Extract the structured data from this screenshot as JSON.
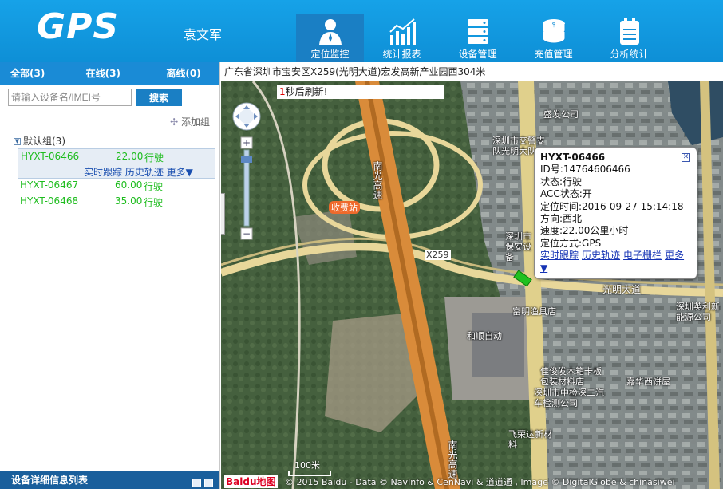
{
  "header": {
    "logo": "GPS",
    "username": "袁文军",
    "nav": [
      {
        "label": "定位监控",
        "icon": "person-icon",
        "active": true
      },
      {
        "label": "统计报表",
        "icon": "chart-icon",
        "active": false
      },
      {
        "label": "设备管理",
        "icon": "server-icon",
        "active": false
      },
      {
        "label": "充值管理",
        "icon": "coins-icon",
        "active": false
      },
      {
        "label": "分析统计",
        "icon": "clipboard-icon",
        "active": false
      }
    ]
  },
  "left": {
    "tabs": [
      "全部(3)",
      "在线(3)",
      "离线(0)"
    ],
    "search_placeholder": "请输入设备名/IMEI号",
    "search_button": "搜索",
    "add_group": "添加组",
    "group_label": "默认组(3)",
    "vehicles": [
      {
        "name": "HYXT-06466",
        "speed": "22.00",
        "status": "行驶"
      },
      {
        "name": "HYXT-06467",
        "speed": "60.00",
        "status": "行驶"
      },
      {
        "name": "HYXT-06468",
        "speed": "35.00",
        "status": "行驶"
      }
    ],
    "vehicle_links": "实时跟踪 历史轨迹 更多▼",
    "bottom_title": "设备详细信息列表"
  },
  "map": {
    "address": "广东省深圳市宝安区X259(光明大道)宏发高新产业园西304米",
    "refresh_count": "1",
    "refresh_text": "秒后刷新!",
    "popup": {
      "title": "HYXT-06466",
      "id": "ID号:14764606466",
      "state": "状态:行驶",
      "acc": "ACC状态:开",
      "time": "定位时间:2016-09-27 15:14:18",
      "direction": "方向:西北",
      "speed": "速度:22.00公里小时",
      "mode": "定位方式:GPS",
      "links": [
        "实时跟踪",
        "历史轨迹",
        "电子栅栏",
        "更多▼"
      ]
    },
    "labels": [
      "盛发公司",
      "深圳市交警支队光明大队",
      "南光高速",
      "收费站",
      "X259",
      "光明大道",
      "富明渔具店",
      "和顺自动",
      "深圳英利新能源公司",
      "佳俊发木箱卡板包装材料店",
      "深圳市中检深二汽车检测公司",
      "嘉华西饼屋",
      "飞荣达新材料",
      "深圳市保安设备",
      "南光高速"
    ],
    "scale": "100米",
    "brand": "Baidu地图",
    "attribution": "© 2015 Baidu - Data © NavInfo & CenNavi & 道道通 , Image © DigitalGlobe & chinasiwei"
  }
}
